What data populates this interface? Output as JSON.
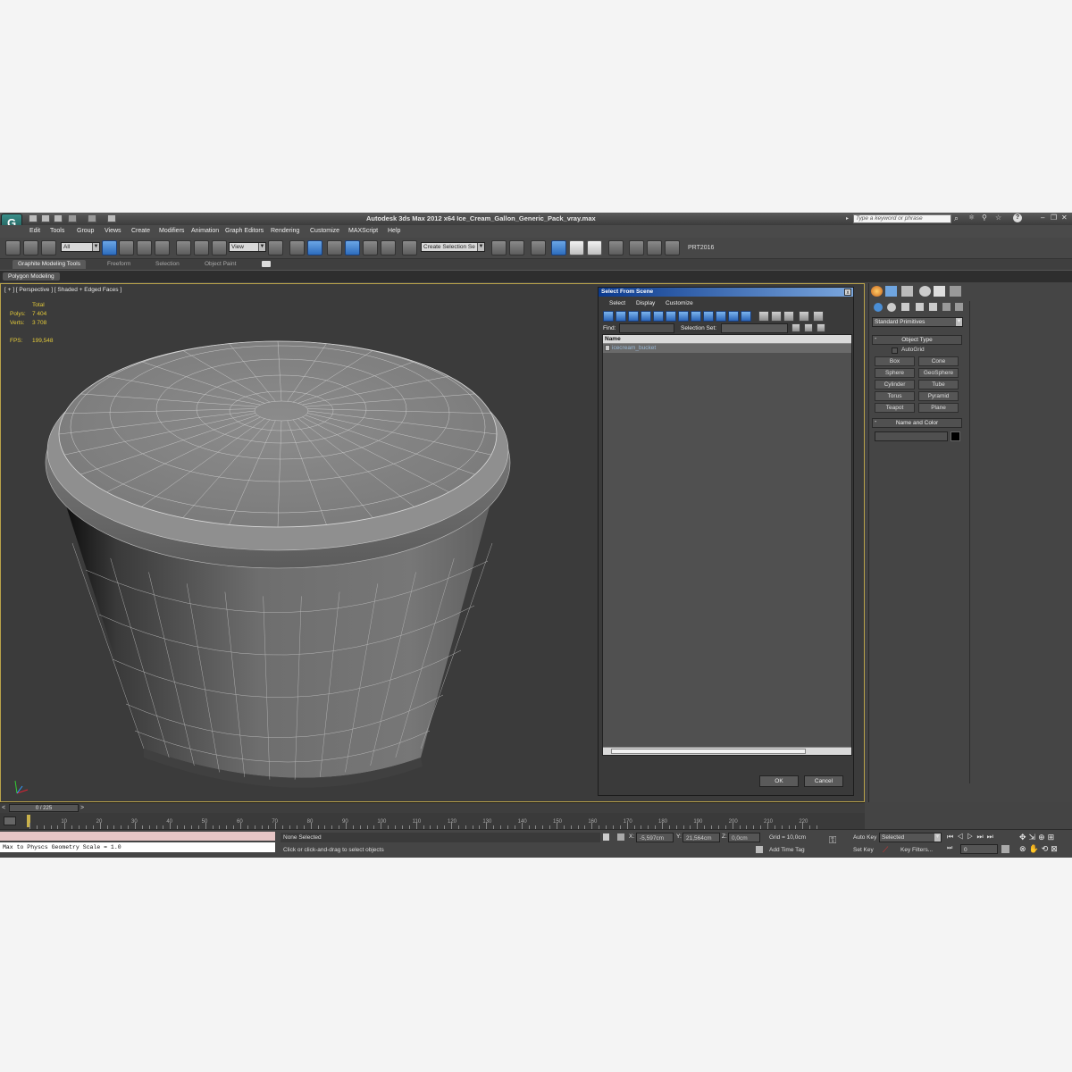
{
  "app": {
    "title": "Autodesk 3ds Max  2012 x64     Ice_Cream_Gallon_Generic_Pack_vray.max",
    "logo_letter": "G",
    "search_placeholder": "Type a keyword or phrase"
  },
  "menubar": [
    "Edit",
    "Tools",
    "Group",
    "Views",
    "Create",
    "Modifiers",
    "Animation",
    "Graph Editors",
    "Rendering",
    "Customize",
    "MAXScript",
    "Help"
  ],
  "toolbar": {
    "filter_value": "All",
    "ref_coord_value": "View",
    "selection_set_value": "Create Selection Se",
    "prt_label": "PRT2016"
  },
  "ribbon": {
    "tabs": [
      "Graphite Modeling Tools",
      "Freeform",
      "Selection",
      "Object Paint"
    ],
    "panel": "Polygon Modeling"
  },
  "viewport": {
    "label": "[ + ] [ Perspective ] [ Shaded + Edged Faces ]",
    "stats_total": "Total",
    "polys_label": "Polys:",
    "polys_value": "7 404",
    "verts_label": "Verts:",
    "verts_value": "3 708",
    "fps_label": "FPS:",
    "fps_value": "199,548"
  },
  "dialog": {
    "title": "Select From Scene",
    "close": "x",
    "menus": [
      "Select",
      "Display",
      "Customize"
    ],
    "find_label": "Find:",
    "selection_set_label": "Selection Set:",
    "column_name": "Name",
    "items": [
      "icecream_bucket"
    ],
    "ok": "OK",
    "cancel": "Cancel"
  },
  "command_panel": {
    "category": "Standard Primitives",
    "object_type_title": "Object Type",
    "autogrid": "AutoGrid",
    "buttons": [
      "Box",
      "Cone",
      "Sphere",
      "GeoSphere",
      "Cylinder",
      "Tube",
      "Torus",
      "Pyramid",
      "Teapot",
      "Plane"
    ],
    "name_color_title": "Name and Color",
    "rollout_marker": "-"
  },
  "timeline": {
    "frame": "0 / 225",
    "ticks": [
      "0",
      "10",
      "20",
      "30",
      "40",
      "50",
      "60",
      "70",
      "80",
      "90",
      "100",
      "110",
      "120",
      "130",
      "140",
      "150",
      "160",
      "170",
      "180",
      "190",
      "200",
      "210",
      "220"
    ]
  },
  "status": {
    "script_output": "Max to Physcs Geometry Scale = 1.0",
    "none_selected": "None Selected",
    "hint": "Click or click-and-drag to select objects",
    "x_label": "X:",
    "x_value": "-5,597cm",
    "y_label": "Y:",
    "y_value": "21,564cm",
    "z_label": "Z:",
    "z_value": "0,0cm",
    "grid": "Grid = 10,0cm",
    "add_time_tag": "Add Time Tag",
    "auto_key": "Auto Key",
    "set_key": "Set Key",
    "selected": "Selected",
    "key_filters": "Key Filters...",
    "frame_field": "0"
  },
  "colors": {
    "accent_blue": "#2d6cbd",
    "viewport_border": "#b8a24a",
    "stats_yellow": "#e2c93a"
  }
}
